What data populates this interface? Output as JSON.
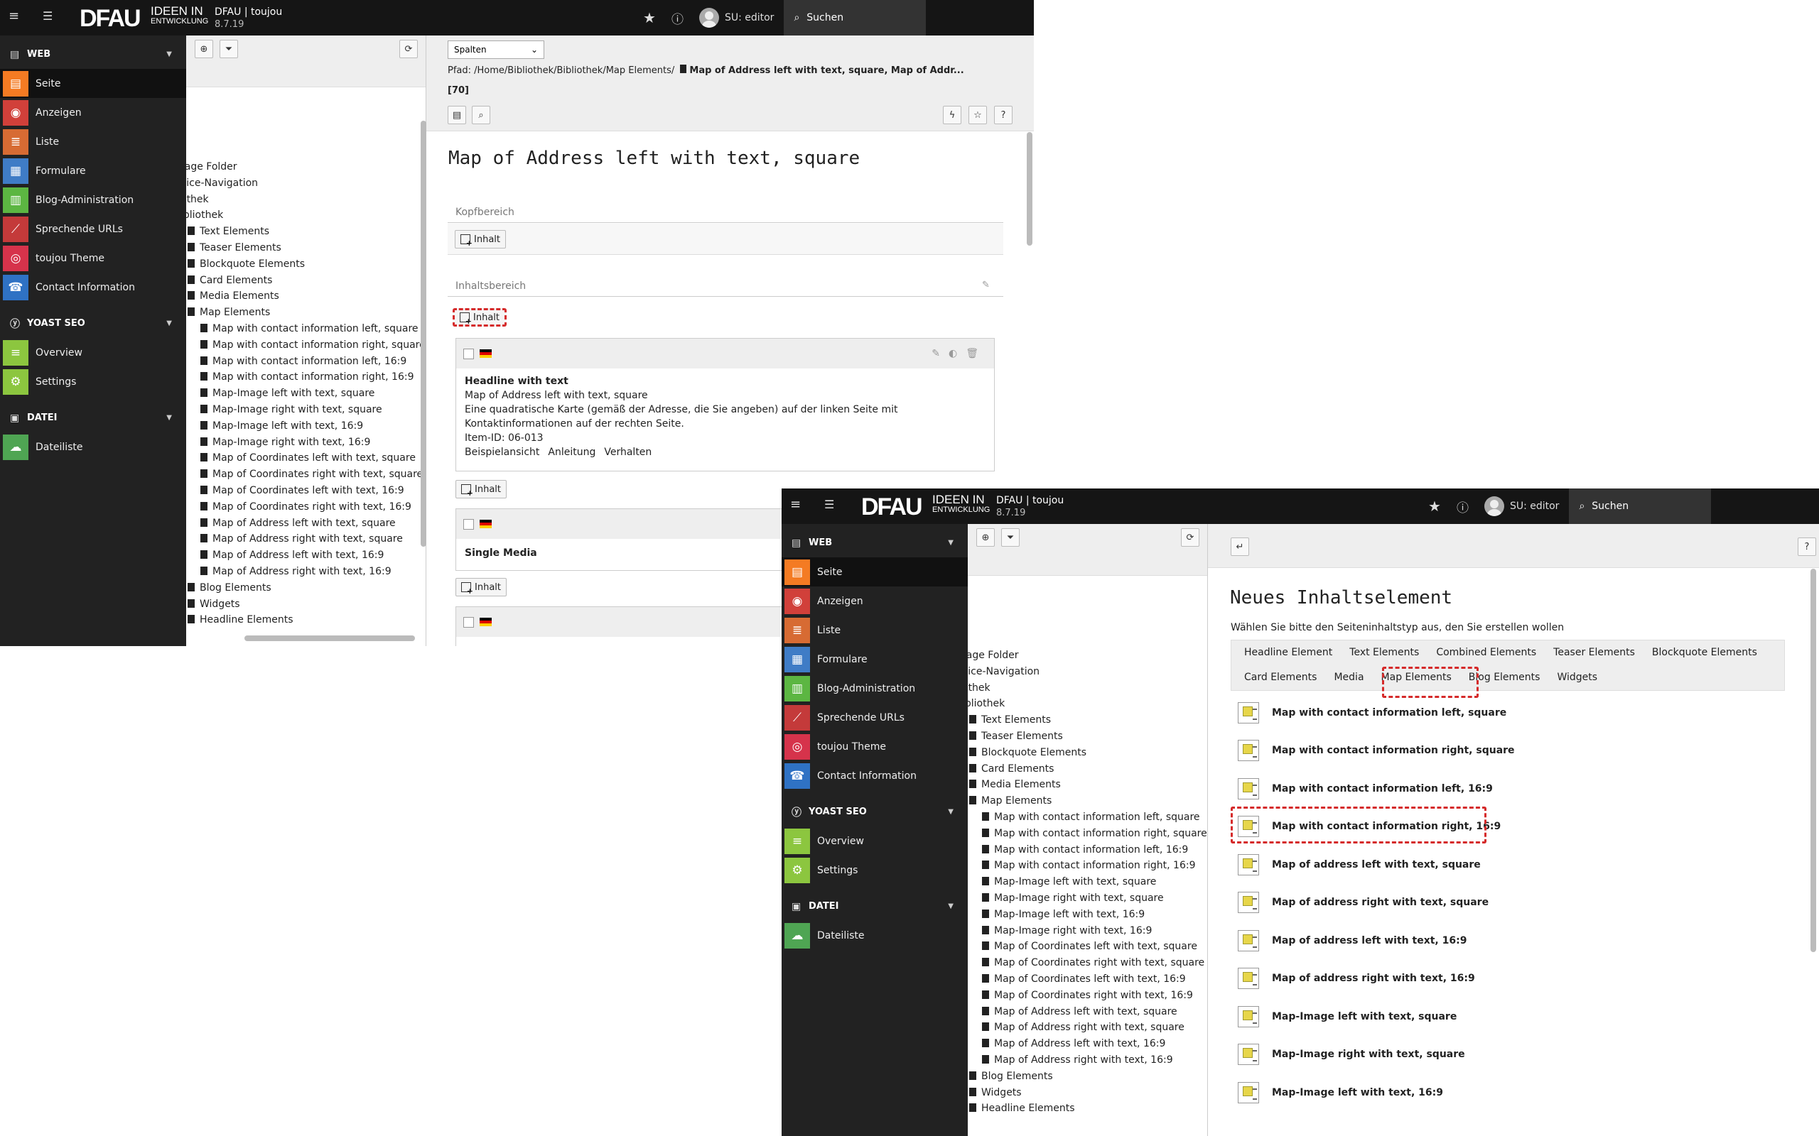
{
  "brand": {
    "logo": "DFAU",
    "logo_sub1": "IDEEN IN",
    "logo_sub2": "ENTWICKLUNG",
    "site_name": "DFAU | toujou",
    "version": "8.7.19"
  },
  "topbar": {
    "user": "SU: editor",
    "search": "Suchen"
  },
  "modules": {
    "web_group": "WEB",
    "seo_group": "YOAST SEO",
    "file_group": "DATEI",
    "web_items": [
      {
        "label": "Seite",
        "color": "#f47b23",
        "icon": "page-icon"
      },
      {
        "label": "Anzeigen",
        "color": "#d1403a",
        "icon": "eye-icon"
      },
      {
        "label": "Liste",
        "color": "#d76b33",
        "icon": "list-icon"
      },
      {
        "label": "Formulare",
        "color": "#3f7cc6",
        "icon": "form-icon"
      },
      {
        "label": "Blog-Administration",
        "color": "#5cb642",
        "icon": "blog-icon"
      },
      {
        "label": "Sprechende URLs",
        "color": "#c43a3a",
        "icon": "url-icon"
      },
      {
        "label": "toujou Theme",
        "color": "#d6334b",
        "icon": "fingerprint-icon"
      },
      {
        "label": "Contact Information",
        "color": "#2f72c4",
        "icon": "contact-icon"
      }
    ],
    "seo_items": [
      {
        "label": "Overview",
        "color": "#8cc63f",
        "icon": "overview-icon"
      },
      {
        "label": "Settings",
        "color": "#8cc63f",
        "icon": "settings-icon"
      }
    ],
    "file_items": [
      {
        "label": "Dateiliste",
        "color": "#4fa553",
        "icon": "cloud-icon"
      }
    ]
  },
  "tree": {
    "nodes": [
      {
        "label": "rage Folder",
        "indent": 0
      },
      {
        "label": "vice-Navigation",
        "indent": 0
      },
      {
        "label": "othek",
        "indent": 0
      },
      {
        "label": "ibliothek",
        "indent": 0
      },
      {
        "label": "Text Elements",
        "indent": 1
      },
      {
        "label": "Teaser Elements",
        "indent": 1
      },
      {
        "label": "Blockquote Elements",
        "indent": 1
      },
      {
        "label": "Card Elements",
        "indent": 1
      },
      {
        "label": "Media Elements",
        "indent": 1
      },
      {
        "label": "Map Elements",
        "indent": 1
      },
      {
        "label": "Map with contact information left, square",
        "indent": 2
      },
      {
        "label": "Map with contact information right, square",
        "indent": 2
      },
      {
        "label": "Map with contact information left, 16:9",
        "indent": 2
      },
      {
        "label": "Map with contact information right, 16:9",
        "indent": 2
      },
      {
        "label": "Map-Image left with text, square",
        "indent": 2
      },
      {
        "label": "Map-Image right with text, square",
        "indent": 2
      },
      {
        "label": "Map-Image left with text, 16:9",
        "indent": 2
      },
      {
        "label": "Map-Image right with text, 16:9",
        "indent": 2
      },
      {
        "label": "Map of Coordinates left with text, square",
        "indent": 2
      },
      {
        "label": "Map of Coordinates right with text, square",
        "indent": 2
      },
      {
        "label": "Map of Coordinates left with text, 16:9",
        "indent": 2
      },
      {
        "label": "Map of Coordinates right with text, 16:9",
        "indent": 2
      },
      {
        "label": "Map of Address left with text, square",
        "indent": 2
      },
      {
        "label": "Map of Address right with text, square",
        "indent": 2
      },
      {
        "label": "Map of Address left with text, 16:9",
        "indent": 2
      },
      {
        "label": "Map of Address right with text, 16:9",
        "indent": 2
      },
      {
        "label": "Blog Elements",
        "indent": 1
      },
      {
        "label": "Widgets",
        "indent": 1
      },
      {
        "label": "Headline Elements",
        "indent": 1
      }
    ]
  },
  "page": {
    "view_select": "Spalten",
    "path_label": "Pfad: /Home/Bibliothek/Bibliothek/Map Elements/",
    "path_current": "Map of Address left with text, square, Map of Addr...",
    "page_id": "[70]",
    "title": "Map of Address left with text, square",
    "col_header": "Kopfbereich",
    "col_content": "Inhaltsbereich",
    "new_content": "Inhalt",
    "ce1": {
      "headline": "Headline with text",
      "subtitle": "Map of Address left with text, square",
      "desc": "Eine quadratische Karte (gemäß der Adresse, die Sie angeben) auf der linken Seite mit Kontaktinformationen auf der rechten Seite.",
      "item_id": "Item-ID: 06-013",
      "links": [
        "Beispielansicht",
        "Anleitung",
        "Verhalten"
      ]
    },
    "ce2": {
      "headline": "Single Media"
    }
  },
  "wizard": {
    "title": "Neues Inhaltselement",
    "intro": "Wählen Sie bitte den Seiteninhaltstyp aus, den Sie erstellen wollen",
    "tabs": [
      "Headline Element",
      "Text Elements",
      "Combined Elements",
      "Teaser Elements",
      "Blockquote Elements",
      "Card Elements",
      "Media",
      "Map Elements",
      "Blog Elements",
      "Widgets"
    ],
    "items": [
      "Map with contact information left, square",
      "Map with contact information right, square",
      "Map with contact information left, 16:9",
      "Map with contact information right, 16:9",
      "Map of address left with text, square",
      "Map of address right with text, square",
      "Map of address left with text, 16:9",
      "Map of address right with text, 16:9",
      "Map-Image left with text, square",
      "Map-Image right with text, square",
      "Map-Image left with text, 16:9"
    ]
  }
}
